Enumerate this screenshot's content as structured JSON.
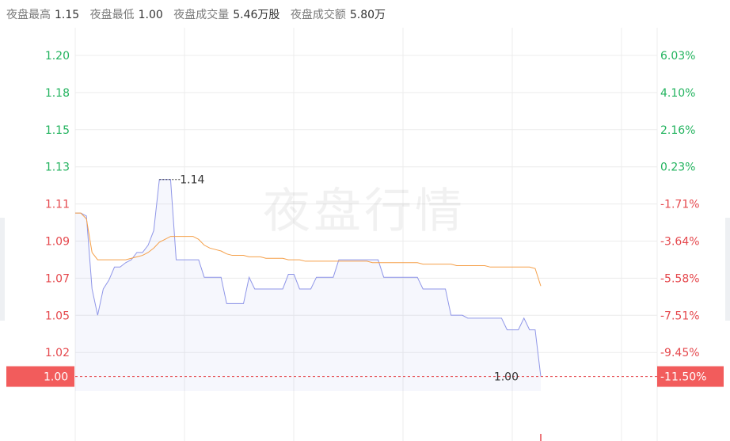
{
  "header": {
    "high_label": "夜盘最高",
    "high_value": "1.15",
    "low_label": "夜盘最低",
    "low_value": "1.00",
    "volume_label": "夜盘成交量",
    "volume_value": "5.46万股",
    "amount_label": "夜盘成交额",
    "amount_value": "5.80万"
  },
  "watermark": "夜盘行情",
  "colors": {
    "up": "#22b35e",
    "down": "#e5484d",
    "price_line": "#8f96e8",
    "avg_line": "#f5a04a",
    "grid": "#ececec",
    "current_badge": "#f25c5c"
  },
  "chart_data": {
    "type": "line",
    "y_ticks_left": [
      "1.20",
      "1.18",
      "1.15",
      "1.13",
      "1.11",
      "1.09",
      "1.07",
      "1.05",
      "1.02"
    ],
    "y_ticks_right": [
      "6.03%",
      "4.10%",
      "2.16%",
      "0.23%",
      "-1.71%",
      "-3.64%",
      "-5.58%",
      "-7.51%",
      "-9.45%"
    ],
    "ylim": [
      0.99,
      1.22
    ],
    "current_price_label": "1.00",
    "current_pct_label": "-11.50%",
    "marker_high_label": "1.14",
    "marker_last_label": "1.00",
    "series": [
      {
        "values": [
          1.112,
          1.112,
          1.11,
          1.06,
          1.042,
          1.06,
          1.066,
          1.075,
          1.075,
          1.078,
          1.08,
          1.085,
          1.085,
          1.09,
          1.1,
          1.135,
          1.135,
          1.135,
          1.08,
          1.08,
          1.08,
          1.08,
          1.08,
          1.068,
          1.068,
          1.068,
          1.068,
          1.05,
          1.05,
          1.05,
          1.05,
          1.068,
          1.06,
          1.06,
          1.06,
          1.06,
          1.06,
          1.06,
          1.07,
          1.07,
          1.06,
          1.06,
          1.06,
          1.068,
          1.068,
          1.068,
          1.068,
          1.08,
          1.08,
          1.08,
          1.08,
          1.08,
          1.08,
          1.08,
          1.08,
          1.068,
          1.068,
          1.068,
          1.068,
          1.068,
          1.068,
          1.068,
          1.06,
          1.06,
          1.06,
          1.06,
          1.06,
          1.042,
          1.042,
          1.042,
          1.04,
          1.04,
          1.04,
          1.04,
          1.04,
          1.04,
          1.04,
          1.032,
          1.032,
          1.032,
          1.04,
          1.032,
          1.032,
          1.0
        ]
      },
      {
        "values": [
          1.112,
          1.112,
          1.108,
          1.085,
          1.08,
          1.08,
          1.08,
          1.08,
          1.08,
          1.08,
          1.081,
          1.082,
          1.083,
          1.085,
          1.088,
          1.092,
          1.094,
          1.096,
          1.096,
          1.096,
          1.096,
          1.096,
          1.094,
          1.09,
          1.088,
          1.087,
          1.086,
          1.084,
          1.083,
          1.083,
          1.083,
          1.082,
          1.082,
          1.082,
          1.081,
          1.081,
          1.081,
          1.081,
          1.08,
          1.08,
          1.08,
          1.079,
          1.079,
          1.079,
          1.079,
          1.079,
          1.079,
          1.079,
          1.079,
          1.079,
          1.079,
          1.079,
          1.079,
          1.078,
          1.078,
          1.078,
          1.078,
          1.078,
          1.078,
          1.078,
          1.078,
          1.078,
          1.077,
          1.077,
          1.077,
          1.077,
          1.077,
          1.077,
          1.076,
          1.076,
          1.076,
          1.076,
          1.076,
          1.076,
          1.075,
          1.075,
          1.075,
          1.075,
          1.075,
          1.075,
          1.075,
          1.075,
          1.074,
          1.062
        ]
      }
    ]
  }
}
